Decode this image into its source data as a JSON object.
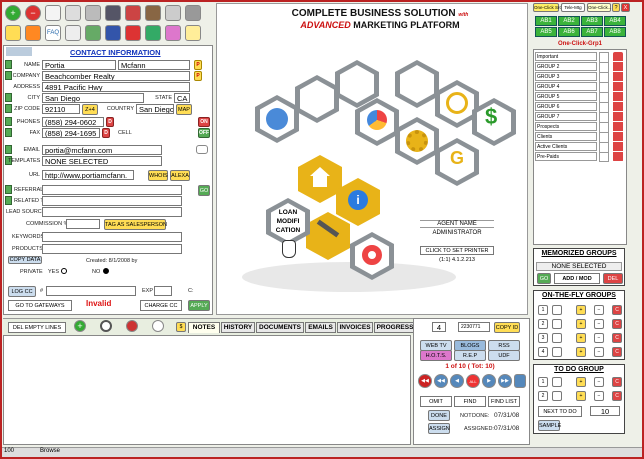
{
  "header": {
    "title": "COMPLETE BUSINESS SOLUTION",
    "title_with": "with",
    "subtitle_advanced": "ADVANCED",
    "subtitle_rest": " MARKETING PLATFORM"
  },
  "top_right": {
    "tab1": "One-Click Srch",
    "tab2": "Tele-Mtg",
    "tab3": "One-Click...",
    "help": "?",
    "close": "X"
  },
  "ab_buttons": [
    "AB1",
    "AB2",
    "AB3",
    "AB4",
    "AB5",
    "AB6",
    "AB7",
    "AB8"
  ],
  "one_click_grp": {
    "label": "One-Click-Grp1",
    "items": [
      "Important",
      "GROUP 2",
      "GROUP 3",
      "GROUP 4",
      "GROUP 5",
      "GROUP 6",
      "GROUP 7",
      "Prospects",
      "Clients",
      "Active Clients",
      "Pre-Paids"
    ]
  },
  "contact": {
    "header": "CONTACT INFORMATION",
    "name_label": "NAME",
    "first": "Portia",
    "last": "Mcfann",
    "company_label": "COMPANY",
    "company": "Beachcomber Realty",
    "address_label": "ADDRESS",
    "address": "4891 Pacific Hwy",
    "city_label": "CITY",
    "city": "San Diego",
    "state_label": "STATE",
    "state": "CA",
    "zip_label": "ZIP CODE",
    "zip": "92110",
    "z4": "Z+4",
    "country_label": "COUNTRY",
    "country": "San Diego",
    "map": "MAP",
    "phones_label": "PHONES",
    "phone": "(858) 294-0602",
    "cell_label": "CELL",
    "fax_label": "FAX",
    "fax": "(858) 294-1695",
    "on": "ON",
    "off": "OFF",
    "email_label": "EMAIL",
    "email": "portia@mcfann.com",
    "templates_label": "TEMPLATES",
    "templates": "NONE SELECTED",
    "url_label": "URL",
    "url": "http://www.portiamcfann.",
    "whois": "WHOIS",
    "alexa": "ALEXA",
    "referrals_label": "REFERRALS",
    "related_label": "RELATED TO",
    "lead_label": "LEAD SOURCE",
    "commission_label": "COMMISSION %",
    "tag_sales": "TAG AS SALESPERSON",
    "keywords_label": "KEYWORDS",
    "products_label": "PRODUCTS",
    "copy_data": "COPY DATA",
    "created": "Created: 8/1/2008  by",
    "private_label": "PRIVATE",
    "yes": "YES",
    "no": "NO",
    "log_cc": "LOG CC",
    "hash": "#",
    "exp": "EXP",
    "c_label": "C:",
    "gateways": "GO TO GATEWAYS",
    "invalid": "Invalid",
    "charge": "CHARGE CC",
    "apply": "APPLY"
  },
  "center": {
    "loan_text": "LOAN MODIFI CATION",
    "agent_name": "AGENT NAME",
    "administrator": "ADMINISTRATOR",
    "set_printer": "CLICK TO SET PRINTER",
    "version": "(1:1) 4.1.2.213"
  },
  "tabs": {
    "del_empty": "DEL EMPTY LINES",
    "notes": "NOTES",
    "history": "HISTORY",
    "documents": "DOCUMENTS",
    "emails": "EMAILS",
    "invoices": "INVOICES",
    "progress": "PROGRESS"
  },
  "record": {
    "count": "4",
    "id": "2230771",
    "copy_id": "COPY ID",
    "web_tv": "WEB TV",
    "blogs": "BLOGS",
    "rss": "RSS",
    "hots": "H.O.T.S.",
    "rep": "R.E.P",
    "udf": "UDF",
    "position": "1 of 10 ( Tot: 10)",
    "omit": "OMIT",
    "find": "FIND",
    "find_list": "FIND LIST",
    "done": "DONE",
    "assign": "ASSIGN",
    "not_label": "NOT",
    "done_label": "DONE:",
    "done_date": "07/31/08",
    "assigned_label": "ASSIGNED:",
    "assigned_date": "07/31/08"
  },
  "memorized": {
    "title": "MEMORIZED GROUPS",
    "selected": "NONE SELECTED",
    "go": "GO",
    "add_mod": "ADD / MOD",
    "del": "DEL"
  },
  "onthefly": {
    "title": "ON-THE-FLY GROUPS",
    "rows": [
      "1",
      "2",
      "3",
      "4"
    ]
  },
  "todo": {
    "title": "TO DO GROUP",
    "rows": [
      "1",
      "2"
    ],
    "next_to_do": "NEXT TO DO",
    "next_value": "10",
    "sample": "SAMPLE"
  },
  "status": {
    "zoom": "100",
    "mode": "Browse"
  },
  "colors": {
    "frame": "#bb2222",
    "green": "#3bb33b",
    "yellow": "#e8b318",
    "hex_gray": "#8b9196"
  }
}
